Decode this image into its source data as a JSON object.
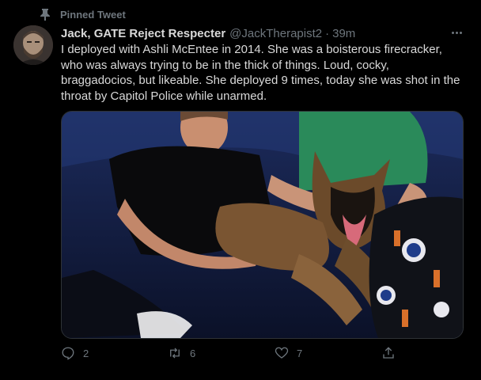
{
  "pinned": {
    "label": "Pinned Tweet",
    "icon": "pin-icon"
  },
  "author": {
    "display_name": "Jack, GATE Reject Respecter",
    "handle": "@JackTherapist2",
    "separator": "·",
    "time": "39m"
  },
  "tweet": {
    "text": "I deployed with Ashli McEntee in 2014. She was a boisterous firecracker, who was always trying to be in the thick of things. Loud, cocky, braggadocios, but likeable. She deployed 9 times, today she was shot in the throat by Capitol Police while unarmed."
  },
  "actions": {
    "reply_count": "2",
    "retweet_count": "6",
    "like_count": "7",
    "reply_icon": "reply-icon",
    "retweet_icon": "retweet-icon",
    "like_icon": "like-icon",
    "share_icon": "share-icon"
  },
  "colors": {
    "background": "#000000",
    "text": "#d9d9d9",
    "secondary": "#6e767d",
    "border": "#2f3336"
  }
}
